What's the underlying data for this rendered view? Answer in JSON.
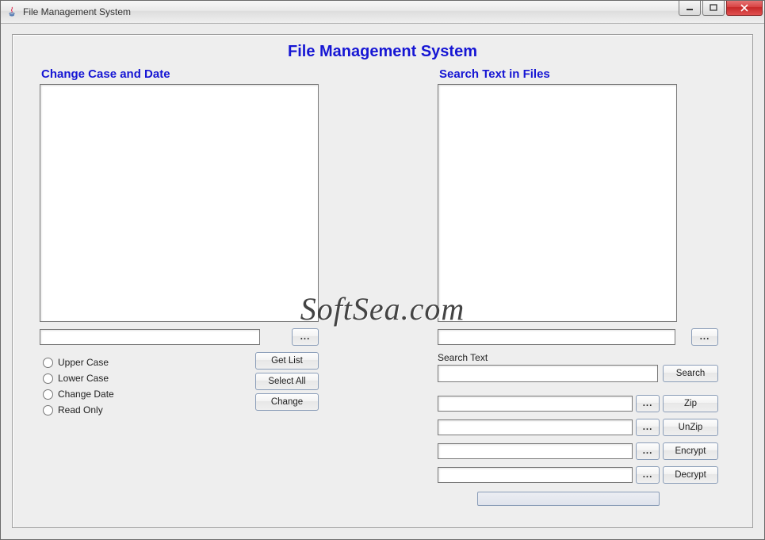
{
  "window": {
    "title": "File Management System"
  },
  "app": {
    "title": "File Management System"
  },
  "left": {
    "heading": "Change Case and Date",
    "path_value": "",
    "browse_label": "...",
    "buttons": {
      "get_list": "Get List",
      "select_all": "Select All",
      "change": "Change"
    },
    "radios": {
      "upper": "Upper Case",
      "lower": "Lower Case",
      "change_date": "Change Date",
      "read_only": "Read Only"
    }
  },
  "right": {
    "heading": "Search Text in Files",
    "path_value": "",
    "browse_label": "...",
    "search_text_label": "Search Text",
    "search_text_value": "",
    "search_button": "Search",
    "actions": {
      "zip": {
        "value": "",
        "browse": "...",
        "button": "Zip"
      },
      "unzip": {
        "value": "",
        "browse": "...",
        "button": "UnZip"
      },
      "encrypt": {
        "value": "",
        "browse": "...",
        "button": "Encrypt"
      },
      "decrypt": {
        "value": "",
        "browse": "...",
        "button": "Decrypt"
      }
    }
  },
  "watermark": "SoftSea.com"
}
